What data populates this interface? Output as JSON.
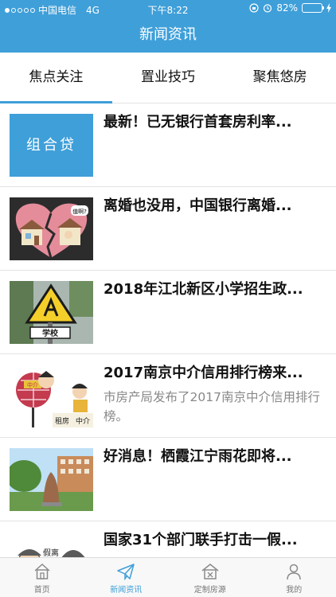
{
  "status_bar": {
    "carrier": "中国电信",
    "network": "4G",
    "time": "下午8:22",
    "battery": "82%",
    "battery_level": 0.82
  },
  "header": {
    "title": "新闻资讯"
  },
  "tabs": [
    {
      "label": "焦点关注",
      "active": true
    },
    {
      "label": "置业技巧",
      "active": false
    },
    {
      "label": "聚焦悠房",
      "active": false
    }
  ],
  "articles": [
    {
      "thumb_text": "组合贷",
      "title": "最新！已无银行首套房利率...",
      "desc": ""
    },
    {
      "thumb_text": "值啊?",
      "title": "离婚也没用，中国银行离婚...",
      "desc": ""
    },
    {
      "thumb_text": "学校",
      "title": "2018年江北新区小学招生政...",
      "desc": ""
    },
    {
      "thumb_text": [
        "中介",
        "租房",
        "中介"
      ],
      "title": "2017南京中介信用排行榜来...",
      "desc": "市房产局发布了2017南京中介信用排行榜。"
    },
    {
      "thumb_text": "",
      "title": "好消息！栖霞江宁雨花即将...",
      "desc": ""
    },
    {
      "thumb_text": "假离",
      "title": "国家31个部门联手打击一假...",
      "desc": ""
    }
  ],
  "tabbar": [
    {
      "label": "首页",
      "icon": "home-icon",
      "active": false
    },
    {
      "label": "新闻资讯",
      "icon": "paper-plane-icon",
      "active": true
    },
    {
      "label": "定制房源",
      "icon": "custom-house-icon",
      "active": false
    },
    {
      "label": "我的",
      "icon": "person-icon",
      "active": false
    }
  ],
  "colors": {
    "accent": "#3f9fd9",
    "battery": "#7ee04a"
  }
}
